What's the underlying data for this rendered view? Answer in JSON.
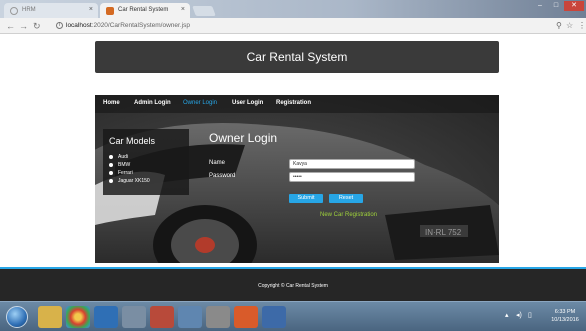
{
  "browser": {
    "tabs": [
      {
        "label": "HRM",
        "active": false
      },
      {
        "label": "Car Rental System",
        "active": true
      }
    ],
    "url_host": "localhost",
    "url_path": ":2020/CarRentalSystem/owner.jsp"
  },
  "site": {
    "title": "Car Rental System",
    "nav": [
      "Home",
      "Admin Login",
      "Owner Login",
      "User Login",
      "Registration"
    ],
    "active_nav": "Owner Login"
  },
  "models": {
    "title": "Car Models",
    "items": [
      "Audi",
      "BMW",
      "Ferrari",
      "Jaguar XK150"
    ]
  },
  "login": {
    "title": "Owner Login",
    "name_label": "Name",
    "name_value": "Kavya",
    "password_label": "Password",
    "password_value": "•••••",
    "submit_label": "Submit",
    "reset_label": "Reset",
    "new_car_link": "New Car Registration"
  },
  "footer": {
    "copyright": "Copyright © Car Rental System"
  },
  "taskbar": {
    "time": "6:33 PM",
    "date": "10/13/2016"
  },
  "colors": {
    "accent": "#27a6e6",
    "link_green": "#9fd23b",
    "header_bg": "#3a3a3a",
    "footer_bg": "#262626"
  }
}
